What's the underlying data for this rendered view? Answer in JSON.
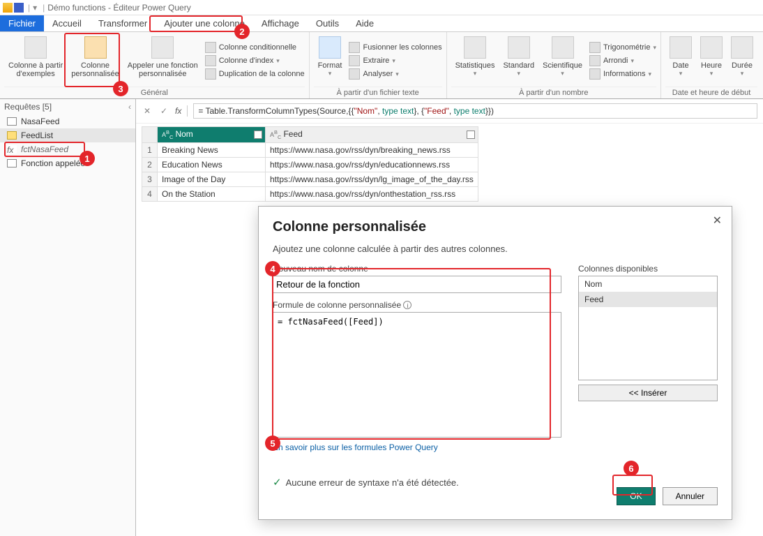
{
  "title": {
    "app": "Démo functions - Éditeur Power Query"
  },
  "ribbon_tabs": {
    "file": "Fichier",
    "accueil": "Accueil",
    "transformer": "Transformer",
    "ajouter": "Ajouter une colonne",
    "affichage": "Affichage",
    "outils": "Outils",
    "aide": "Aide"
  },
  "ribbon": {
    "col_ex": "Colonne à partir\nd'exemples",
    "col_pers": "Colonne\npersonnalisée",
    "invoke_fn": "Appeler une fonction\npersonnalisée",
    "cond": "Colonne conditionnelle",
    "index": "Colonne d'index",
    "dup": "Duplication de la colonne",
    "group1": "Général",
    "format": "Format",
    "merge": "Fusionner les colonnes",
    "extract": "Extraire",
    "analyse": "Analyser",
    "group2": "À partir d'un fichier texte",
    "stats": "Statistiques",
    "standard": "Standard",
    "sci": "Scientifique",
    "trig": "Trigonométrie",
    "round": "Arrondi",
    "info": "Informations",
    "group3": "À partir d'un nombre",
    "date": "Date",
    "heure": "Heure",
    "duree": "Durée",
    "group4": "Date et heure de début"
  },
  "queries": {
    "head": "Requêtes [5]",
    "nasa": "NasaFeed",
    "feedlist": "FeedList",
    "fct": "fctNasaFeed",
    "appelee": "Fonction appelée"
  },
  "formula": {
    "prefix": "= Table.TransformColumnTypes(Source,{{",
    "s1": "\"Nom\"",
    "k1": "type text",
    "mid": "}, {",
    "s2": "\"Feed\"",
    "k2": "type text",
    "end": "}})"
  },
  "table": {
    "col1": "Nom",
    "col2": "Feed",
    "rows": [
      {
        "n": "1",
        "nom": "Breaking News",
        "url": "https://www.nasa.gov/rss/dyn/breaking_news.rss"
      },
      {
        "n": "2",
        "nom": "Education News",
        "url": "https://www.nasa.gov/rss/dyn/educationnews.rss"
      },
      {
        "n": "3",
        "nom": "Image of the Day",
        "url": "https://www.nasa.gov/rss/dyn/lg_image_of_the_day.rss"
      },
      {
        "n": "4",
        "nom": "On the Station",
        "url": "https://www.nasa.gov/rss/dyn/onthestation_rss.rss"
      }
    ]
  },
  "dialog": {
    "title": "Colonne personnalisée",
    "sub": "Ajoutez une colonne calculée à partir des autres colonnes.",
    "lbl_name": "Nouveau nom de colonne",
    "name_val": "Retour de la fonction",
    "lbl_formula": "Formule de colonne personnalisée",
    "formula_val": "= fctNasaFeed([Feed])",
    "lbl_cols": "Colonnes disponibles",
    "cols": {
      "c1": "Nom",
      "c2": "Feed"
    },
    "insert": "<< Insérer",
    "link": "En savoir plus sur les formules Power Query",
    "status": "Aucune erreur de syntaxe n'a été détectée.",
    "ok": "OK",
    "cancel": "Annuler"
  }
}
